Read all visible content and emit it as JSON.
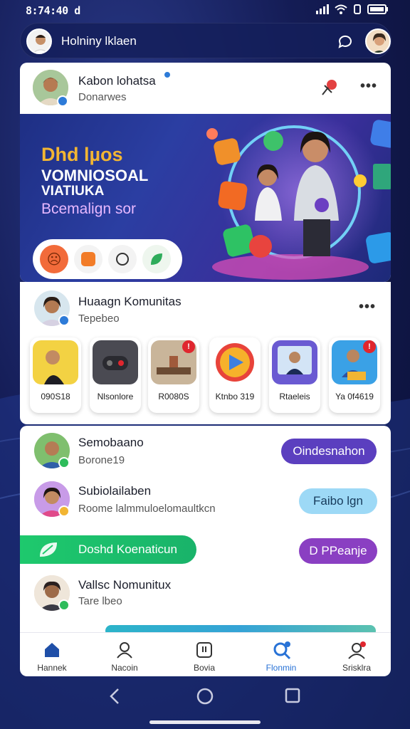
{
  "status_bar": {
    "time": "8:74:40",
    "carrier_icon": "d"
  },
  "top_bar": {
    "title": "Holniny lklaen"
  },
  "post": {
    "author": "Kabon lohatsa",
    "subtitle": "Donarwes",
    "hero": {
      "line1": "Dhd lµos",
      "line2": "VOMNIOSOAL",
      "line3": "VIATIUKA",
      "line4": "Bcemalign sor"
    },
    "reactions": [
      "angry-face-icon",
      "fire-icon",
      "chat-bubble-icon",
      "leaf-icon"
    ]
  },
  "community": {
    "title": "Huaagn Komunitas",
    "subtitle": "Tepebeo",
    "stories": [
      {
        "label": "090S18",
        "badge": "",
        "icon": "person-thumb"
      },
      {
        "label": "Nlsonlore",
        "badge": "",
        "icon": "game-controller-thumb"
      },
      {
        "label": "R0080S",
        "badge": "!",
        "icon": "desk-thumb"
      },
      {
        "label": "Ktnbo 319",
        "badge": "",
        "icon": "play-store-thumb"
      },
      {
        "label": "Rtaeleis",
        "badge": "",
        "icon": "video-thumb"
      },
      {
        "label": "Ya 0f4619",
        "badge": "!",
        "icon": "person-thumb"
      }
    ]
  },
  "list": {
    "rows": [
      {
        "name": "Semobaano",
        "sub": "Borone19",
        "button": "Oindesnahon"
      },
      {
        "name": "Subiolailaben",
        "sub": "Roome lalmmuloelomaultkcn",
        "button": "Faibo lgn"
      }
    ],
    "green_bar": "Doshd Koenaticun",
    "purple_button": "D PPeanje",
    "row3": {
      "name": "Vallsc Nomunitux",
      "sub": "Tare lbeo"
    }
  },
  "bottom_nav": [
    {
      "label": "Hannek",
      "icon": "home-icon"
    },
    {
      "label": "Nacoin",
      "icon": "profile-icon"
    },
    {
      "label": "Bovia",
      "icon": "bookmark-icon"
    },
    {
      "label": "Flonmin",
      "icon": "search-icon"
    },
    {
      "label": "Srisklra",
      "icon": "user-icon"
    }
  ],
  "colors": {
    "accent": "#2872d6",
    "purple": "#5b3fbf",
    "green": "#1ec96d",
    "light_blue": "#9dd9f6"
  }
}
